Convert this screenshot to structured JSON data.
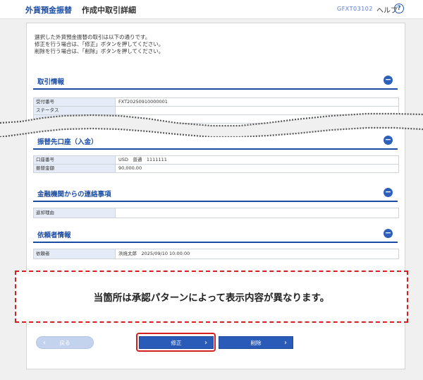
{
  "header": {
    "service": "外貨預金振替",
    "page_title": "作成中取引詳細",
    "screen_id": "GFXT03102",
    "help_label": "ヘルプ",
    "help_icon": "?"
  },
  "intro": {
    "line1": "選択した外貨預金振替の取引は以下の通りです。",
    "line2": "修正を行う場合は、「修正」ボタンを押してください。",
    "line3": "削除を行う場合は、「削除」ボタンを押してください。"
  },
  "sections": {
    "transaction": {
      "title": "取引情報",
      "rows": [
        {
          "label": "受付番号",
          "value": "FXT20250910000001"
        },
        {
          "label": "ステータス",
          "value": ""
        }
      ]
    },
    "destination": {
      "title": "振替先口座（入金）",
      "rows": [
        {
          "label": "口座番号",
          "value": "USD　普通　1111111"
        },
        {
          "label": "振替金額",
          "value": "90,000.00"
        }
      ]
    },
    "bank_message": {
      "title": "金融機関からの連絡事項",
      "rows": [
        {
          "label": "返却理由",
          "value": ""
        }
      ]
    },
    "requester": {
      "title": "依頼者情報",
      "rows": [
        {
          "label": "依頼者",
          "value": "浜焼太郎　2025/09/10 10:00:00"
        }
      ]
    }
  },
  "notice": "当箇所は承認パターンによって表示内容が異なります。",
  "buttons": {
    "back": "戻る",
    "edit": "修正",
    "delete": "削除"
  },
  "colors": {
    "accent": "#1b4ca3",
    "highlight": "#d42020"
  }
}
